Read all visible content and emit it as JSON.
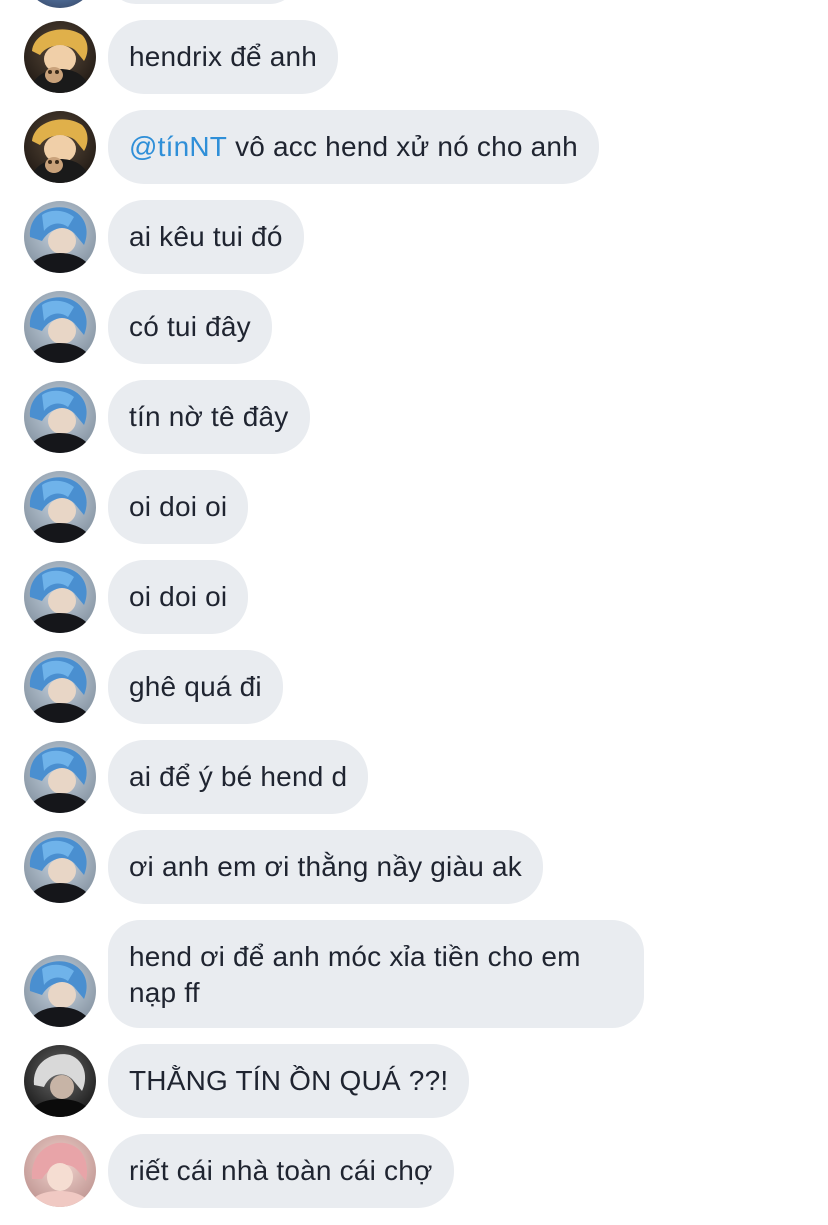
{
  "messages": [
    {
      "author_avatar": "avatar-orange-hair",
      "text": "hendrix để anh"
    },
    {
      "author_avatar": "avatar-orange-hair",
      "mention": "@tínNT",
      "text": " vô acc hend xử nó cho anh"
    },
    {
      "author_avatar": "avatar-blue-hair",
      "text": "ai kêu tui đó"
    },
    {
      "author_avatar": "avatar-blue-hair",
      "text": "có tui đây"
    },
    {
      "author_avatar": "avatar-blue-hair",
      "text": "tín nờ tê đây"
    },
    {
      "author_avatar": "avatar-blue-hair",
      "text": "oi doi oi"
    },
    {
      "author_avatar": "avatar-blue-hair",
      "text": "oi doi oi"
    },
    {
      "author_avatar": "avatar-blue-hair",
      "text": "ghê quá đi"
    },
    {
      "author_avatar": "avatar-blue-hair",
      "text": "ai để ý bé hend d"
    },
    {
      "author_avatar": "avatar-blue-hair",
      "text": "ơi anh em ơi thằng nầy giàu ak"
    },
    {
      "author_avatar": "avatar-blue-hair",
      "text_line1": "hend ơi để anh móc xỉa tiền cho em",
      "text_line2": "nạp ff"
    },
    {
      "author_avatar": "avatar-dark-hair",
      "text": "THẰNG TÍN ỒN QUÁ ??!"
    },
    {
      "author_avatar": "avatar-pink-hair",
      "text": "riết cái nhà toàn cái chợ"
    }
  ],
  "colors": {
    "bubble_background": "#e9ecf0",
    "text": "#1f2430",
    "mention": "#2f8fd8"
  }
}
